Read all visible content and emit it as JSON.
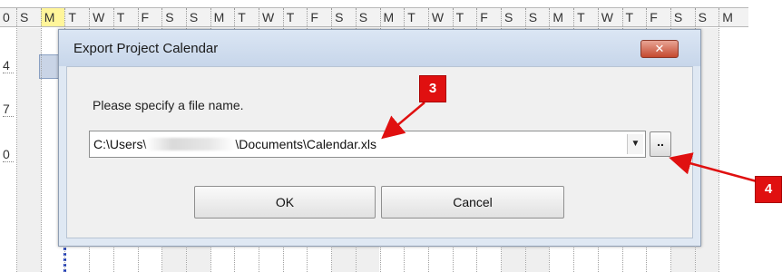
{
  "timescale": {
    "left_label": "0",
    "days": [
      "S",
      "M",
      "T",
      "W",
      "T",
      "F",
      "S",
      "S",
      "M",
      "T",
      "W",
      "T",
      "F",
      "S",
      "S",
      "M",
      "T",
      "W",
      "T",
      "F",
      "S",
      "S",
      "M",
      "T",
      "W",
      "T",
      "F",
      "S",
      "S",
      "M"
    ],
    "today_label": "M"
  },
  "row_numbers": [
    "4",
    "7",
    "0"
  ],
  "dialog": {
    "title": "Export Project Calendar",
    "close_label": "✕",
    "prompt": "Please specify a file name.",
    "file_path_prefix": "C:\\Users\\",
    "file_path_suffix": "\\Documents\\Calendar.xls",
    "browse_label": "..",
    "ok_label": "OK",
    "cancel_label": "Cancel"
  },
  "callouts": {
    "file_field": "3",
    "browse_button": "4"
  },
  "colors": {
    "callout": "#e01010",
    "today_highlight": "#fff59a",
    "title_bar": "#c7d6ea"
  }
}
